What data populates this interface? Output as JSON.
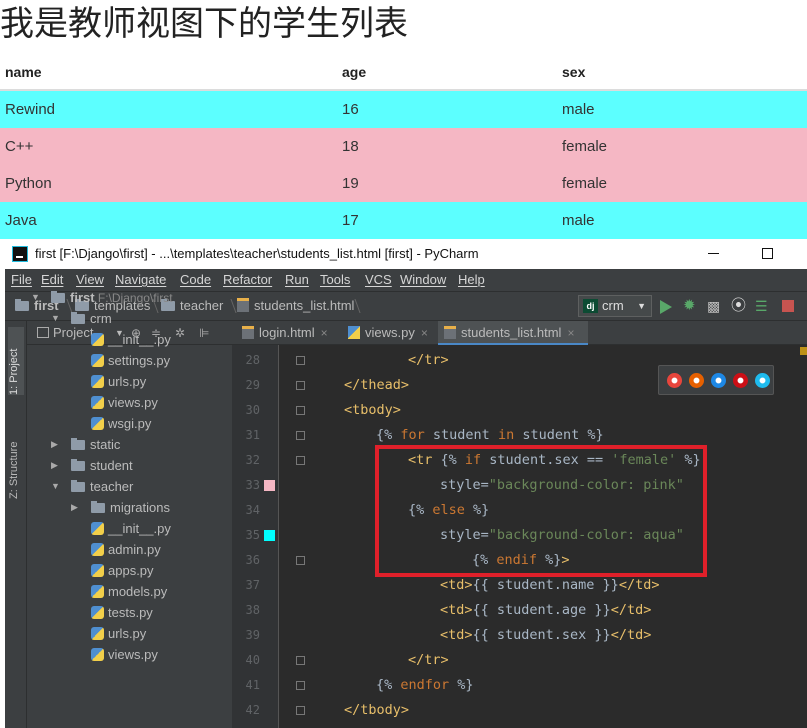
{
  "page": {
    "title": "我是教师视图下的学生列表",
    "columns": [
      "name",
      "age",
      "sex"
    ],
    "rows": [
      {
        "name": "Rewind",
        "age": "16",
        "sex": "male",
        "color": "#5cffff"
      },
      {
        "name": "C++",
        "age": "18",
        "sex": "female",
        "color": "#f5b7c4"
      },
      {
        "name": "Python",
        "age": "19",
        "sex": "female",
        "color": "#f5b7c4"
      },
      {
        "name": "Java",
        "age": "17",
        "sex": "male",
        "color": "#5cffff"
      }
    ]
  },
  "ide": {
    "window_title": "first [F:\\Django\\first] - ...\\templates\\teacher\\students_list.html [first] - PyCharm",
    "menu": [
      "File",
      "Edit",
      "View",
      "Navigate",
      "Code",
      "Refactor",
      "Run",
      "Tools",
      "VCS",
      "Window",
      "Help"
    ],
    "breadcrumbs": [
      "first",
      "templates",
      "teacher",
      "students_list.html"
    ],
    "run_config": "crm",
    "run_config_badge": "dj",
    "side_tabs": [
      "1: Project",
      "Z: Structure"
    ],
    "project_label": "Project",
    "tree": [
      {
        "label": "first",
        "extra": "F:\\Django\\first",
        "type": "folder",
        "depth": 0,
        "open": true
      },
      {
        "label": "crm",
        "type": "folder",
        "depth": 1,
        "open": true
      },
      {
        "label": "__init__.py",
        "type": "py",
        "depth": 2
      },
      {
        "label": "settings.py",
        "type": "py",
        "depth": 2
      },
      {
        "label": "urls.py",
        "type": "py",
        "depth": 2
      },
      {
        "label": "views.py",
        "type": "py",
        "depth": 2
      },
      {
        "label": "wsgi.py",
        "type": "py",
        "depth": 2
      },
      {
        "label": "static",
        "type": "folder",
        "depth": 1,
        "open": false
      },
      {
        "label": "student",
        "type": "folder",
        "depth": 1,
        "open": false
      },
      {
        "label": "teacher",
        "type": "folder",
        "depth": 1,
        "open": true
      },
      {
        "label": "migrations",
        "type": "folder",
        "depth": 2,
        "open": false
      },
      {
        "label": "__init__.py",
        "type": "py",
        "depth": 2
      },
      {
        "label": "admin.py",
        "type": "py",
        "depth": 2
      },
      {
        "label": "apps.py",
        "type": "py",
        "depth": 2
      },
      {
        "label": "models.py",
        "type": "py",
        "depth": 2
      },
      {
        "label": "tests.py",
        "type": "py",
        "depth": 2
      },
      {
        "label": "urls.py",
        "type": "py",
        "depth": 2
      },
      {
        "label": "views.py",
        "type": "py",
        "depth": 2
      }
    ],
    "tabs": [
      {
        "label": "login.html",
        "type": "html",
        "active": false
      },
      {
        "label": "views.py",
        "type": "py",
        "active": false
      },
      {
        "label": "students_list.html",
        "type": "html",
        "active": true
      }
    ],
    "code_lines": [
      {
        "n": "28",
        "indent": 2,
        "segs": [
          [
            "tg",
            "</tr>"
          ]
        ]
      },
      {
        "n": "29",
        "indent": 0,
        "segs": [
          [
            "tg",
            "</thead>"
          ]
        ]
      },
      {
        "n": "30",
        "indent": 0,
        "segs": [
          [
            "tg",
            "<tbody>"
          ]
        ]
      },
      {
        "n": "31",
        "indent": 1,
        "segs": [
          [
            "tx",
            "{% "
          ],
          [
            "kw",
            "for"
          ],
          [
            "tx",
            " student "
          ],
          [
            "kw",
            "in"
          ],
          [
            "tx",
            " student %}"
          ]
        ]
      },
      {
        "n": "32",
        "indent": 2,
        "segs": [
          [
            "tg",
            "<tr"
          ],
          [
            "tx",
            " {% "
          ],
          [
            "kw",
            "if"
          ],
          [
            "tx",
            " student.sex == "
          ],
          [
            "st",
            "'female'"
          ],
          [
            "tx",
            " %}"
          ]
        ]
      },
      {
        "n": "33",
        "indent": 3,
        "segs": [
          [
            "tx",
            "style="
          ],
          [
            "st",
            "\"background-color: pink\""
          ]
        ],
        "swatch": "#f5b7c4"
      },
      {
        "n": "34",
        "indent": 2,
        "segs": [
          [
            "tx",
            "{% "
          ],
          [
            "kw",
            "else"
          ],
          [
            "tx",
            " %}"
          ]
        ]
      },
      {
        "n": "35",
        "indent": 3,
        "segs": [
          [
            "tx",
            "style="
          ],
          [
            "st",
            "\"background-color: aqua\""
          ]
        ],
        "swatch": "#00ffff"
      },
      {
        "n": "36",
        "indent": 4,
        "segs": [
          [
            "tx",
            "{% "
          ],
          [
            "kw",
            "endif"
          ],
          [
            "tx",
            " %}"
          ],
          [
            "tg",
            ">"
          ]
        ]
      },
      {
        "n": "37",
        "indent": 3,
        "segs": [
          [
            "tg",
            "<td>"
          ],
          [
            "tx",
            "{{ student.name }}"
          ],
          [
            "tg",
            "</td>"
          ]
        ]
      },
      {
        "n": "38",
        "indent": 3,
        "segs": [
          [
            "tg",
            "<td>"
          ],
          [
            "tx",
            "{{ student.age }}"
          ],
          [
            "tg",
            "</td>"
          ]
        ]
      },
      {
        "n": "39",
        "indent": 3,
        "segs": [
          [
            "tg",
            "<td>"
          ],
          [
            "tx",
            "{{ student.sex }}"
          ],
          [
            "tg",
            "</td>"
          ]
        ]
      },
      {
        "n": "40",
        "indent": 2,
        "segs": [
          [
            "tg",
            "</tr>"
          ]
        ]
      },
      {
        "n": "41",
        "indent": 1,
        "segs": [
          [
            "tx",
            "{% "
          ],
          [
            "kw",
            "endfor"
          ],
          [
            "tx",
            " %}"
          ]
        ]
      },
      {
        "n": "42",
        "indent": 0,
        "segs": [
          [
            "tg",
            "</tbody>"
          ]
        ]
      }
    ],
    "browser_icons": [
      {
        "name": "chrome-icon",
        "color": "#e8453c"
      },
      {
        "name": "firefox-icon",
        "color": "#e66000"
      },
      {
        "name": "safari-icon",
        "color": "#1e88e5"
      },
      {
        "name": "opera-icon",
        "color": "#cc0f16"
      },
      {
        "name": "ie-icon",
        "color": "#1ebbee"
      }
    ]
  }
}
